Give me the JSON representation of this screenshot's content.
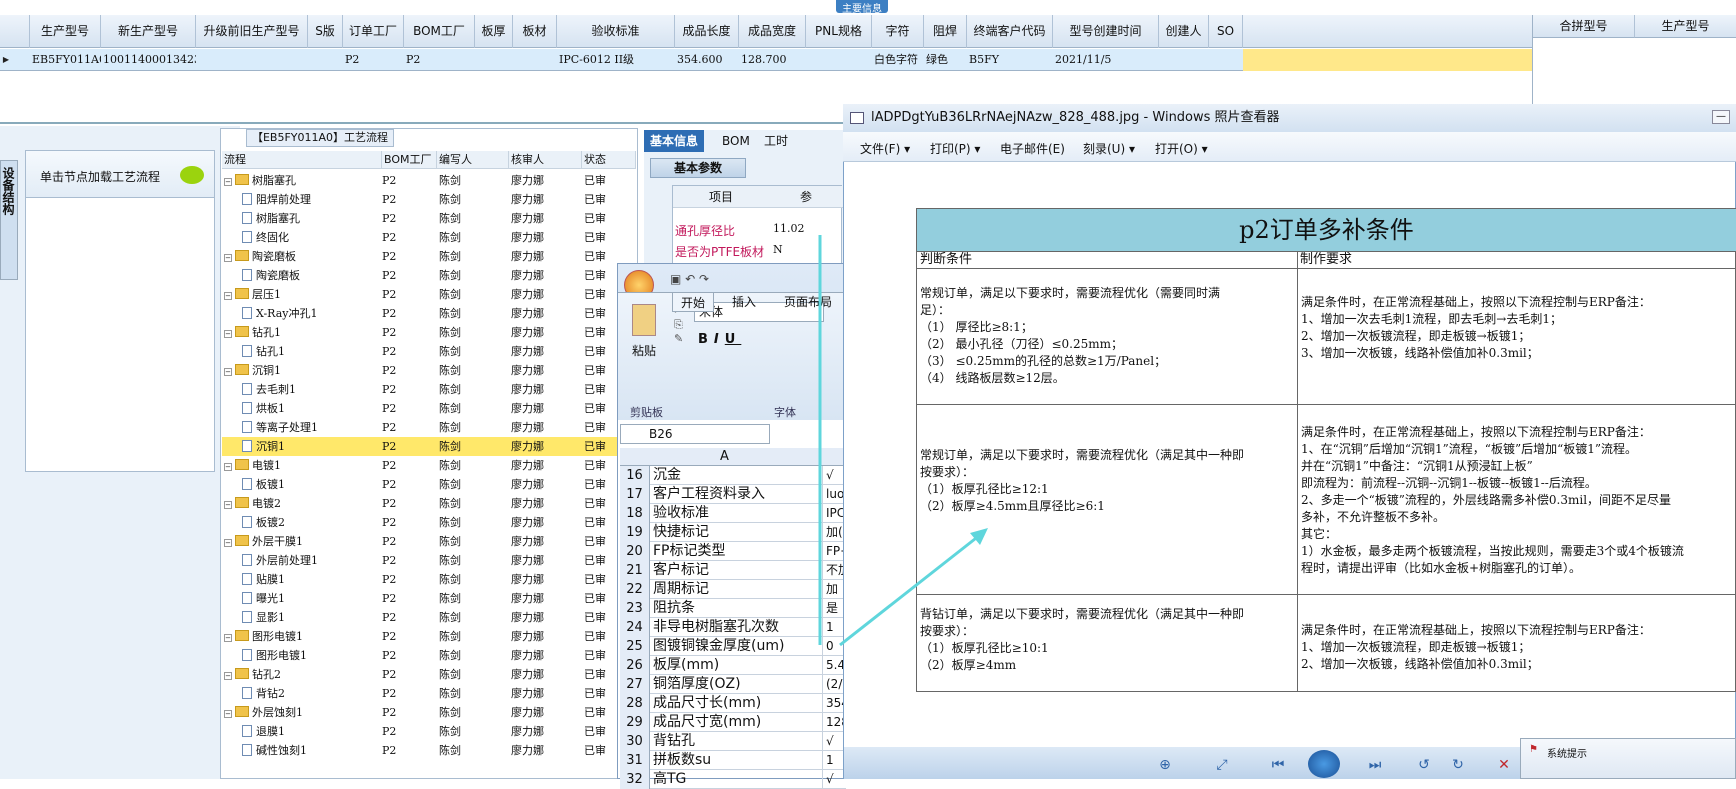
{
  "top": {
    "caption": "主要信息",
    "columns": [
      "生产型号",
      "新生产型号",
      "升级前旧生产型号",
      "S版",
      "订单工厂",
      "BOM工厂",
      "板厚",
      "板材",
      "验收标准",
      "成品长度",
      "成品宽度",
      "PNL规格",
      "字符",
      "阻焊",
      "终端客户代码",
      "型号创建时间",
      "创建人",
      "SO"
    ],
    "row": [
      "EB5FY011A0",
      "10011400013423",
      "",
      "",
      "P2",
      "P2",
      "",
      "",
      "IPC-6012 II级",
      "354.600",
      "128.700",
      "",
      "白色字符",
      "绿色",
      "B5FY",
      "2021/11/5",
      "",
      ""
    ],
    "right_columns": [
      "合拼型号",
      "生产型号"
    ]
  },
  "left": {
    "vertical_tab": "设备结构",
    "panel_header": "单击节点加载工艺流程"
  },
  "tree": {
    "title": "【EB5FY011A0】工艺流程",
    "headers": [
      "流程",
      "BOM工厂",
      "编写人",
      "核审人",
      "状态"
    ],
    "rows": [
      {
        "name": "树脂塞孔",
        "kind": "folder",
        "bom": "P2",
        "writer": "陈剑",
        "reviewer": "廖力娜",
        "status": "已审"
      },
      {
        "name": "阻焊前处理",
        "kind": "doc",
        "bom": "P2",
        "writer": "陈剑",
        "reviewer": "廖力娜",
        "status": "已审"
      },
      {
        "name": "树脂塞孔",
        "kind": "doc",
        "bom": "P2",
        "writer": "陈剑",
        "reviewer": "廖力娜",
        "status": "已审"
      },
      {
        "name": "终固化",
        "kind": "doc",
        "bom": "P2",
        "writer": "陈剑",
        "reviewer": "廖力娜",
        "status": "已审"
      },
      {
        "name": "陶瓷磨板",
        "kind": "folder",
        "bom": "P2",
        "writer": "陈剑",
        "reviewer": "廖力娜",
        "status": "已审"
      },
      {
        "name": "陶瓷磨板",
        "kind": "doc",
        "bom": "P2",
        "writer": "陈剑",
        "reviewer": "廖力娜",
        "status": "已审"
      },
      {
        "name": "层压1",
        "kind": "folder",
        "bom": "P2",
        "writer": "陈剑",
        "reviewer": "廖力娜",
        "status": "已审"
      },
      {
        "name": "X-Ray冲孔1",
        "kind": "doc",
        "bom": "P2",
        "writer": "陈剑",
        "reviewer": "廖力娜",
        "status": "已审"
      },
      {
        "name": "钻孔1",
        "kind": "folder",
        "bom": "P2",
        "writer": "陈剑",
        "reviewer": "廖力娜",
        "status": "已审"
      },
      {
        "name": "钻孔1",
        "kind": "doc",
        "bom": "P2",
        "writer": "陈剑",
        "reviewer": "廖力娜",
        "status": "已审"
      },
      {
        "name": "沉铜1",
        "kind": "folder",
        "bom": "P2",
        "writer": "陈剑",
        "reviewer": "廖力娜",
        "status": "已审"
      },
      {
        "name": "去毛刺1",
        "kind": "doc",
        "bom": "P2",
        "writer": "陈剑",
        "reviewer": "廖力娜",
        "status": "已审"
      },
      {
        "name": "烘板1",
        "kind": "doc",
        "bom": "P2",
        "writer": "陈剑",
        "reviewer": "廖力娜",
        "status": "已审"
      },
      {
        "name": "等离子处理1",
        "kind": "doc",
        "bom": "P2",
        "writer": "陈剑",
        "reviewer": "廖力娜",
        "status": "已审"
      },
      {
        "name": "沉铜1",
        "kind": "doc",
        "bom": "P2",
        "writer": "陈剑",
        "reviewer": "廖力娜",
        "status": "已审",
        "selected": true
      },
      {
        "name": "电镀1",
        "kind": "folder",
        "bom": "P2",
        "writer": "陈剑",
        "reviewer": "廖力娜",
        "status": "已审"
      },
      {
        "name": "板镀1",
        "kind": "doc",
        "bom": "P2",
        "writer": "陈剑",
        "reviewer": "廖力娜",
        "status": "已审"
      },
      {
        "name": "电镀2",
        "kind": "folder",
        "bom": "P2",
        "writer": "陈剑",
        "reviewer": "廖力娜",
        "status": "已审"
      },
      {
        "name": "板镀2",
        "kind": "doc",
        "bom": "P2",
        "writer": "陈剑",
        "reviewer": "廖力娜",
        "status": "已审"
      },
      {
        "name": "外层干膜1",
        "kind": "folder",
        "bom": "P2",
        "writer": "陈剑",
        "reviewer": "廖力娜",
        "status": "已审"
      },
      {
        "name": "外层前处理1",
        "kind": "doc",
        "bom": "P2",
        "writer": "陈剑",
        "reviewer": "廖力娜",
        "status": "已审"
      },
      {
        "name": "贴膜1",
        "kind": "doc",
        "bom": "P2",
        "writer": "陈剑",
        "reviewer": "廖力娜",
        "status": "已审"
      },
      {
        "name": "曝光1",
        "kind": "doc",
        "bom": "P2",
        "writer": "陈剑",
        "reviewer": "廖力娜",
        "status": "已审"
      },
      {
        "name": "显影1",
        "kind": "doc",
        "bom": "P2",
        "writer": "陈剑",
        "reviewer": "廖力娜",
        "status": "已审"
      },
      {
        "name": "图形电镀1",
        "kind": "folder",
        "bom": "P2",
        "writer": "陈剑",
        "reviewer": "廖力娜",
        "status": "已审"
      },
      {
        "name": "图形电镀1",
        "kind": "doc",
        "bom": "P2",
        "writer": "陈剑",
        "reviewer": "廖力娜",
        "status": "已审"
      },
      {
        "name": "钻孔2",
        "kind": "folder",
        "bom": "P2",
        "writer": "陈剑",
        "reviewer": "廖力娜",
        "status": "已审"
      },
      {
        "name": "背钻2",
        "kind": "doc",
        "bom": "P2",
        "writer": "陈剑",
        "reviewer": "廖力娜",
        "status": "已审"
      },
      {
        "name": "外层蚀刻1",
        "kind": "folder",
        "bom": "P2",
        "writer": "陈剑",
        "reviewer": "廖力娜",
        "status": "已审"
      },
      {
        "name": "退膜1",
        "kind": "doc",
        "bom": "P2",
        "writer": "陈剑",
        "reviewer": "廖力娜",
        "status": "已审"
      },
      {
        "name": "碱性蚀刻1",
        "kind": "doc",
        "bom": "P2",
        "writer": "陈剑",
        "reviewer": "廖力娜",
        "status": "已审"
      }
    ]
  },
  "basic": {
    "tabs": [
      "基本信息",
      "BOM",
      "工时"
    ],
    "sub_tab": "基本参数",
    "headers": [
      "项目",
      "参"
    ],
    "rows": [
      {
        "label": "通孔厚径比",
        "value": "11.02"
      },
      {
        "label": "是否为PTFE板材",
        "value": "N"
      }
    ]
  },
  "excel": {
    "tabs": [
      "开始",
      "插入",
      "页面布局"
    ],
    "paste_label": "粘贴",
    "clipboard_label": "剪贴板",
    "font_label": "字体",
    "font_name": "宋体",
    "name_box": "B26",
    "col_a": "A",
    "rows": [
      {
        "n": "16",
        "a": "沉金",
        "b": "√"
      },
      {
        "n": "17",
        "a": "客户工程资料录入",
        "b": "luopi"
      },
      {
        "n": "18",
        "a": "验收标准",
        "b": "IPC-6"
      },
      {
        "n": "19",
        "a": "快捷标记",
        "b": "加(MI"
      },
      {
        "n": "20",
        "a": "FP标记类型",
        "b": "FP+E板"
      },
      {
        "n": "21",
        "a": "客户标记",
        "b": "不加"
      },
      {
        "n": "22",
        "a": "周期标记",
        "b": "加"
      },
      {
        "n": "23",
        "a": "阻抗条",
        "b": "是"
      },
      {
        "n": "24",
        "a": "非导电树脂塞孔次数",
        "b": "1"
      },
      {
        "n": "25",
        "a": "图镀铜镍金厚度(um)",
        "b": "0"
      },
      {
        "n": "26",
        "a": "板厚(mm)",
        "b": "5.4"
      },
      {
        "n": "27",
        "a": "铜箔厚度(OZ)",
        "b": "(2/0"
      },
      {
        "n": "28",
        "a": "成品尺寸长(mm)",
        "b": "354.6"
      },
      {
        "n": "29",
        "a": "成品尺寸宽(mm)",
        "b": "128.7"
      },
      {
        "n": "30",
        "a": "背钻孔",
        "b": "√"
      },
      {
        "n": "31",
        "a": "拼板数su",
        "b": "1"
      },
      {
        "n": "32",
        "a": "高TG",
        "b": "√"
      }
    ]
  },
  "viewer": {
    "title": "lADPDgtYuB36LRrNAejNAzw_828_488.jpg - Windows 照片查看器",
    "menu": [
      "文件(F)",
      "打印(P)",
      "电子邮件(E)",
      "刻录(U)",
      "打开(O)"
    ],
    "doc_title": "p2订单多补条件",
    "col_condition": "判断条件",
    "col_requirement": "制作要求",
    "rows": [
      {
        "condition": "常规订单，满足以下要求时，需要流程优化（需要同时满\n足）：\n（1） 厚径比≥8:1；\n（2） 最小孔径（刀径）≤0.25mm；\n（3） ≤0.25mm的孔径的总数≥1万/Panel；\n（4） 线路板层数≥12层。",
        "requirement": "满足条件时，在正常流程基础上，按照以下流程控制与ERP备注：\n1、增加一次去毛刺1流程，即去毛刺→去毛刺1；\n2、增加一次板镀流程，即走板镀→板镀1；\n3、增加一次板镀，线路补偿值加补0.3mil；"
      },
      {
        "condition": "常规订单，满足以下要求时，需要流程优化（满足其中一种即\n按要求）：\n（1）板厚孔径比≥12:1\n（2）板厚≥4.5mm且厚径比≥6:1",
        "requirement": "满足条件时，在正常流程基础上，按照以下流程控制与ERP备注：\n1、在“沉铜”后增加“沉铜1”流程，“板镀”后增加“板镀1”流程。\n并在“沉铜1”中备注：“沉铜1从预浸缸上板”\n即流程为：前流程--沉铜--沉铜1--板镀--板镀1--后流程。\n2、多走一个“板镀”流程的，外层线路需多补偿0.3mil，间距不足尽量\n多补，不允许整板不多补。\n其它：\n1）水金板，最多走两个板镀流程，当按此规则，需要走3个或4个板镀流\n程时，请提出评审（比如水金板+树脂塞孔的订单）。"
      },
      {
        "condition": "背钻订单，满足以下要求时，需要流程优化（满足其中一种即\n按要求）：\n（1）板厚孔径比≥10:1\n（2）板厚≥4mm",
        "requirement": "满足条件时，在正常流程基础上，按照以下流程控制与ERP备注：\n1、增加一次板镀流程，即走板镀→板镀1；\n2、增加一次板镀，线路补偿值加补0.3mil；"
      }
    ]
  },
  "system": {
    "notice": "系统提示"
  },
  "colors": {
    "accent": "#2e6db4",
    "selected_row": "#ffe86a",
    "table_title_bg": "#93cedd",
    "arrow": "#5fd6dc"
  }
}
